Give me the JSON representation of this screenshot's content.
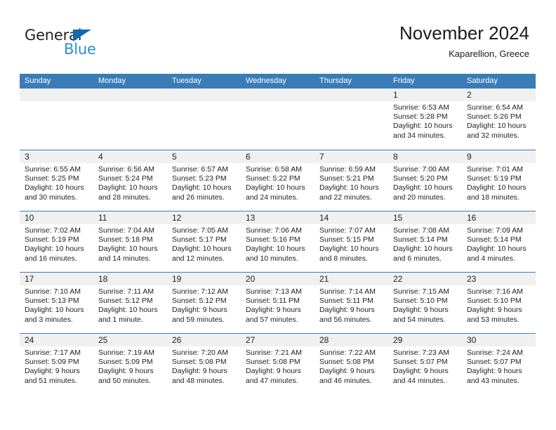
{
  "brand": {
    "name_part1": "General",
    "name_part2": "Blue",
    "colors": {
      "dark": "#231f20",
      "blue": "#2a8fd4",
      "triangle": "#1268b3"
    }
  },
  "header": {
    "title": "November 2024",
    "subtitle": "Kaparellion, Greece"
  },
  "theme": {
    "header_bg": "#3b7cb8",
    "header_text": "#ffffff",
    "day_band_bg": "#f0f0f0",
    "row_separator": "#3b7cb8",
    "cell_bg": "#ffffff",
    "text": "#222222"
  },
  "weekdays": [
    "Sunday",
    "Monday",
    "Tuesday",
    "Wednesday",
    "Thursday",
    "Friday",
    "Saturday"
  ],
  "weeks": [
    [
      {
        "day": "",
        "sunrise": "",
        "sunset": "",
        "daylight": "",
        "empty": true
      },
      {
        "day": "",
        "sunrise": "",
        "sunset": "",
        "daylight": "",
        "empty": true
      },
      {
        "day": "",
        "sunrise": "",
        "sunset": "",
        "daylight": "",
        "empty": true
      },
      {
        "day": "",
        "sunrise": "",
        "sunset": "",
        "daylight": "",
        "empty": true
      },
      {
        "day": "",
        "sunrise": "",
        "sunset": "",
        "daylight": "",
        "empty": true
      },
      {
        "day": "1",
        "sunrise": "Sunrise: 6:53 AM",
        "sunset": "Sunset: 5:28 PM",
        "daylight": "Daylight: 10 hours and 34 minutes.",
        "empty": false
      },
      {
        "day": "2",
        "sunrise": "Sunrise: 6:54 AM",
        "sunset": "Sunset: 5:26 PM",
        "daylight": "Daylight: 10 hours and 32 minutes.",
        "empty": false
      }
    ],
    [
      {
        "day": "3",
        "sunrise": "Sunrise: 6:55 AM",
        "sunset": "Sunset: 5:25 PM",
        "daylight": "Daylight: 10 hours and 30 minutes.",
        "empty": false
      },
      {
        "day": "4",
        "sunrise": "Sunrise: 6:56 AM",
        "sunset": "Sunset: 5:24 PM",
        "daylight": "Daylight: 10 hours and 28 minutes.",
        "empty": false
      },
      {
        "day": "5",
        "sunrise": "Sunrise: 6:57 AM",
        "sunset": "Sunset: 5:23 PM",
        "daylight": "Daylight: 10 hours and 26 minutes.",
        "empty": false
      },
      {
        "day": "6",
        "sunrise": "Sunrise: 6:58 AM",
        "sunset": "Sunset: 5:22 PM",
        "daylight": "Daylight: 10 hours and 24 minutes.",
        "empty": false
      },
      {
        "day": "7",
        "sunrise": "Sunrise: 6:59 AM",
        "sunset": "Sunset: 5:21 PM",
        "daylight": "Daylight: 10 hours and 22 minutes.",
        "empty": false
      },
      {
        "day": "8",
        "sunrise": "Sunrise: 7:00 AM",
        "sunset": "Sunset: 5:20 PM",
        "daylight": "Daylight: 10 hours and 20 minutes.",
        "empty": false
      },
      {
        "day": "9",
        "sunrise": "Sunrise: 7:01 AM",
        "sunset": "Sunset: 5:19 PM",
        "daylight": "Daylight: 10 hours and 18 minutes.",
        "empty": false
      }
    ],
    [
      {
        "day": "10",
        "sunrise": "Sunrise: 7:02 AM",
        "sunset": "Sunset: 5:19 PM",
        "daylight": "Daylight: 10 hours and 16 minutes.",
        "empty": false
      },
      {
        "day": "11",
        "sunrise": "Sunrise: 7:04 AM",
        "sunset": "Sunset: 5:18 PM",
        "daylight": "Daylight: 10 hours and 14 minutes.",
        "empty": false
      },
      {
        "day": "12",
        "sunrise": "Sunrise: 7:05 AM",
        "sunset": "Sunset: 5:17 PM",
        "daylight": "Daylight: 10 hours and 12 minutes.",
        "empty": false
      },
      {
        "day": "13",
        "sunrise": "Sunrise: 7:06 AM",
        "sunset": "Sunset: 5:16 PM",
        "daylight": "Daylight: 10 hours and 10 minutes.",
        "empty": false
      },
      {
        "day": "14",
        "sunrise": "Sunrise: 7:07 AM",
        "sunset": "Sunset: 5:15 PM",
        "daylight": "Daylight: 10 hours and 8 minutes.",
        "empty": false
      },
      {
        "day": "15",
        "sunrise": "Sunrise: 7:08 AM",
        "sunset": "Sunset: 5:14 PM",
        "daylight": "Daylight: 10 hours and 6 minutes.",
        "empty": false
      },
      {
        "day": "16",
        "sunrise": "Sunrise: 7:09 AM",
        "sunset": "Sunset: 5:14 PM",
        "daylight": "Daylight: 10 hours and 4 minutes.",
        "empty": false
      }
    ],
    [
      {
        "day": "17",
        "sunrise": "Sunrise: 7:10 AM",
        "sunset": "Sunset: 5:13 PM",
        "daylight": "Daylight: 10 hours and 3 minutes.",
        "empty": false
      },
      {
        "day": "18",
        "sunrise": "Sunrise: 7:11 AM",
        "sunset": "Sunset: 5:12 PM",
        "daylight": "Daylight: 10 hours and 1 minute.",
        "empty": false
      },
      {
        "day": "19",
        "sunrise": "Sunrise: 7:12 AM",
        "sunset": "Sunset: 5:12 PM",
        "daylight": "Daylight: 9 hours and 59 minutes.",
        "empty": false
      },
      {
        "day": "20",
        "sunrise": "Sunrise: 7:13 AM",
        "sunset": "Sunset: 5:11 PM",
        "daylight": "Daylight: 9 hours and 57 minutes.",
        "empty": false
      },
      {
        "day": "21",
        "sunrise": "Sunrise: 7:14 AM",
        "sunset": "Sunset: 5:11 PM",
        "daylight": "Daylight: 9 hours and 56 minutes.",
        "empty": false
      },
      {
        "day": "22",
        "sunrise": "Sunrise: 7:15 AM",
        "sunset": "Sunset: 5:10 PM",
        "daylight": "Daylight: 9 hours and 54 minutes.",
        "empty": false
      },
      {
        "day": "23",
        "sunrise": "Sunrise: 7:16 AM",
        "sunset": "Sunset: 5:10 PM",
        "daylight": "Daylight: 9 hours and 53 minutes.",
        "empty": false
      }
    ],
    [
      {
        "day": "24",
        "sunrise": "Sunrise: 7:17 AM",
        "sunset": "Sunset: 5:09 PM",
        "daylight": "Daylight: 9 hours and 51 minutes.",
        "empty": false
      },
      {
        "day": "25",
        "sunrise": "Sunrise: 7:19 AM",
        "sunset": "Sunset: 5:09 PM",
        "daylight": "Daylight: 9 hours and 50 minutes.",
        "empty": false
      },
      {
        "day": "26",
        "sunrise": "Sunrise: 7:20 AM",
        "sunset": "Sunset: 5:08 PM",
        "daylight": "Daylight: 9 hours and 48 minutes.",
        "empty": false
      },
      {
        "day": "27",
        "sunrise": "Sunrise: 7:21 AM",
        "sunset": "Sunset: 5:08 PM",
        "daylight": "Daylight: 9 hours and 47 minutes.",
        "empty": false
      },
      {
        "day": "28",
        "sunrise": "Sunrise: 7:22 AM",
        "sunset": "Sunset: 5:08 PM",
        "daylight": "Daylight: 9 hours and 46 minutes.",
        "empty": false
      },
      {
        "day": "29",
        "sunrise": "Sunrise: 7:23 AM",
        "sunset": "Sunset: 5:07 PM",
        "daylight": "Daylight: 9 hours and 44 minutes.",
        "empty": false
      },
      {
        "day": "30",
        "sunrise": "Sunrise: 7:24 AM",
        "sunset": "Sunset: 5:07 PM",
        "daylight": "Daylight: 9 hours and 43 minutes.",
        "empty": false
      }
    ]
  ]
}
